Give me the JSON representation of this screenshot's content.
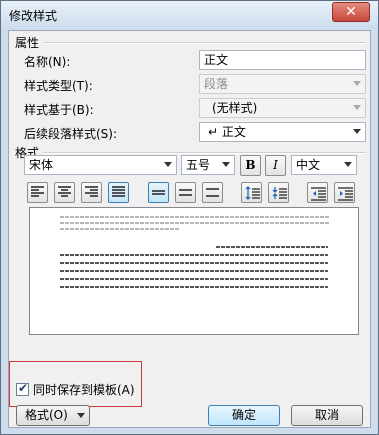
{
  "dialog": {
    "title": "修改样式"
  },
  "properties": {
    "section_label": "属性",
    "name_label": "名称(N):",
    "name_value": "正文",
    "style_type_label": "样式类型(T):",
    "style_type_value": "段落",
    "based_on_label": "样式基于(B):",
    "based_on_value": "(无样式)",
    "next_style_label": "后续段落样式(S):",
    "next_style_value": "正文",
    "next_style_icon": "paragraph-return-icon"
  },
  "format": {
    "section_label": "格式",
    "font_value": "宋体",
    "size_value": "五号",
    "bold_label": "B",
    "italic_label": "I",
    "lang_value": "中文"
  },
  "save_to_template": {
    "label": "同时保存到模板(A)",
    "checked": true
  },
  "buttons": {
    "format_label": "格式(O)",
    "ok_label": "确定",
    "cancel_label": "取消"
  },
  "colors": {
    "highlight_box": "#d23b3b",
    "active_button": "#c4e5f6"
  }
}
